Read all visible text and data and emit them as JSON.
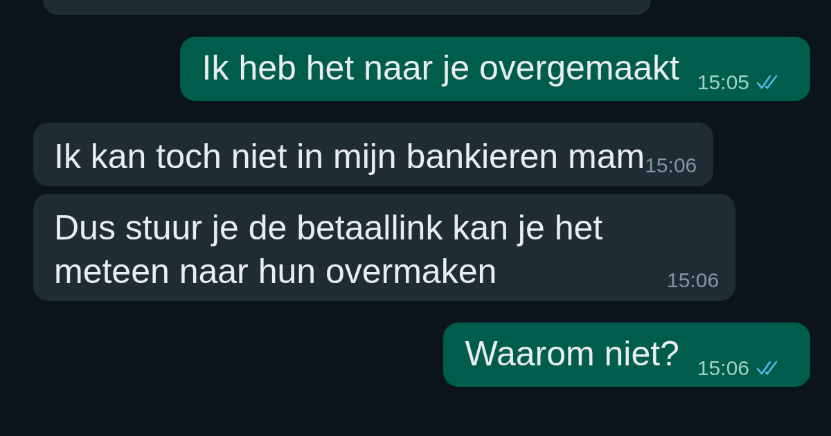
{
  "messages": [
    {
      "kind": "incoming"
    },
    {
      "kind": "outgoing",
      "text": "Ik heb het naar je overgemaakt",
      "time": "15:05",
      "read": true
    },
    {
      "kind": "incoming",
      "text": "Ik kan toch niet in mijn bankieren mam",
      "time": "15:06"
    },
    {
      "kind": "incoming",
      "text": "Dus stuur je de betaallink kan je het meteen naar hun overmaken",
      "time": "15:06"
    },
    {
      "kind": "outgoing",
      "text": "Waarom niet?",
      "time": "15:06",
      "read": true
    }
  ]
}
